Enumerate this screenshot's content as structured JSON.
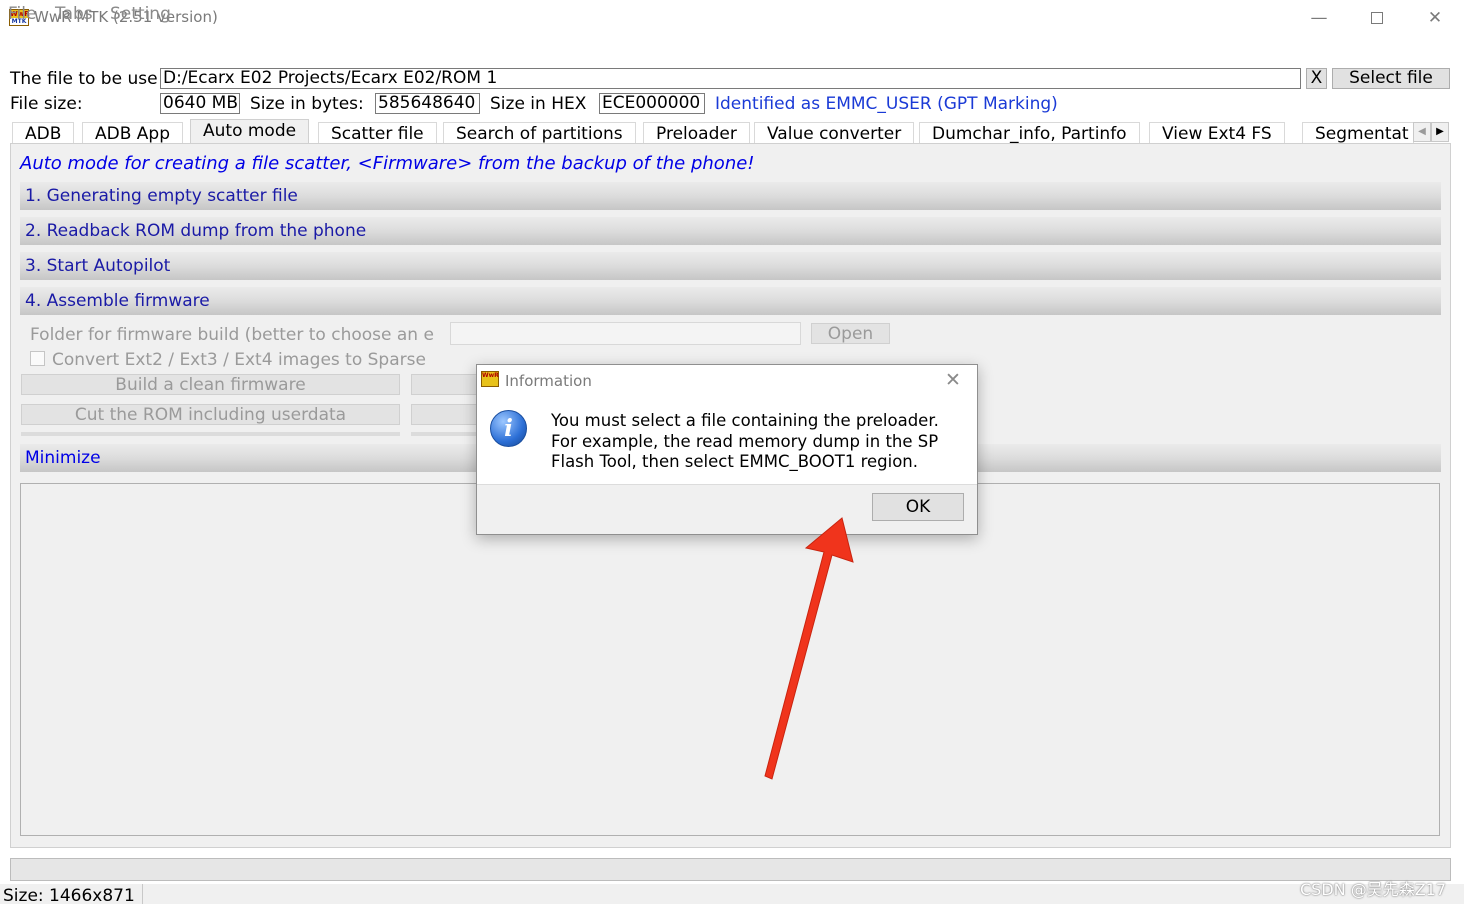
{
  "window": {
    "title": "WwR MTK (2.51 version)",
    "icon_text_top": "WwR",
    "icon_text_bottom": "MTK"
  },
  "menu": [
    "File",
    "Tabs",
    "Setting"
  ],
  "file_row": {
    "label": "The file to be use",
    "path": "D:/Ecarx E02 Projects/Ecarx E02/ROM 1",
    "clear_label": "X",
    "select_label": "Select file"
  },
  "size_row": {
    "file_size_label": "File size:",
    "file_size_value": "0640 MB",
    "bytes_label": "Size in bytes:",
    "bytes_value": "585648640",
    "hex_label": "Size in HEX",
    "hex_value": "ECE000000",
    "identified": "Identified as EMMC_USER (GPT Marking)"
  },
  "tabs": [
    "ADB",
    "ADB App",
    "Auto mode",
    "Scatter file",
    "Search of partitions",
    "Preloader",
    "Value converter",
    "Dumchar_info, Partinfo",
    "View Ext4  FS",
    "Segmentat"
  ],
  "auto_mode": {
    "caption": "Auto mode for creating a file scatter, <Firmware> from the backup of the phone!",
    "sections": [
      "1. Generating empty scatter file",
      "2. Readback ROM dump from the phone",
      "3. Start Autopilot",
      "4. Assemble firmware"
    ],
    "folder_label": "Folder for firmware build (better to choose an e",
    "open_label": "Open",
    "sparse_label": "Convert Ext2 / Ext3 / Ext4 images to Sparse",
    "build_label": "Build a clean firmware",
    "cut_label": "Cut the ROM including userdata",
    "minimize_label": "Minimize"
  },
  "status": {
    "size_text": "Size: 1466x871",
    "watermark": "CSDN @吴先森Z17"
  },
  "dialog": {
    "title": "Information",
    "icon": "info-icon",
    "lines": [
      "You must select a file containing the preloader.",
      "For example, the read memory dump in the SP",
      "Flash Tool, then select EMMC_BOOT1 region."
    ],
    "ok_label": "OK"
  },
  "colors": {
    "link_blue": "#0000e6",
    "section_text": "#1a1aa6",
    "annotation_arrow": "#f0341c"
  }
}
